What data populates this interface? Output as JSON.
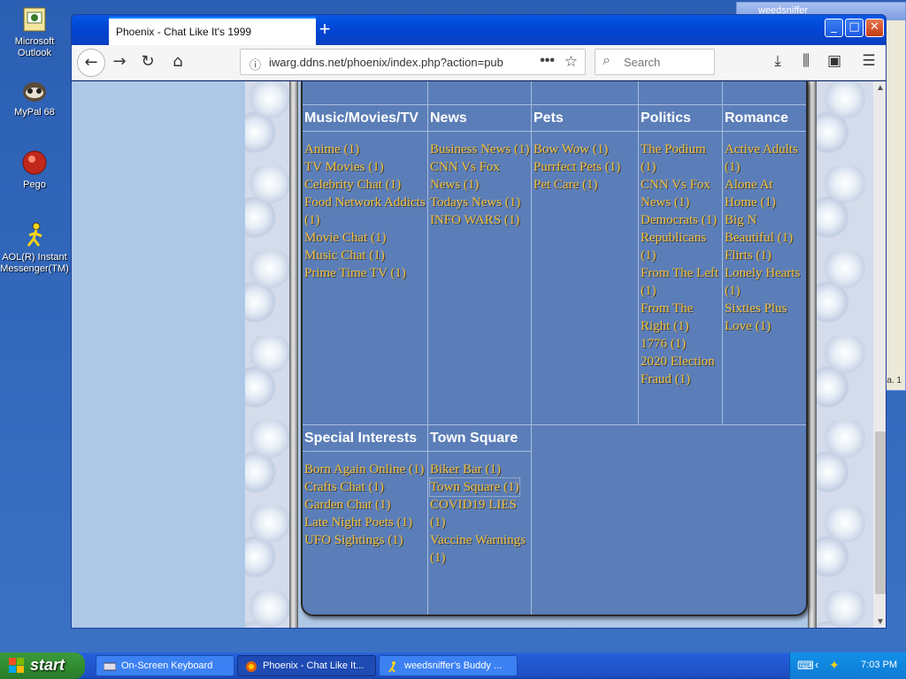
{
  "desktop": {
    "icons": [
      {
        "label": "Microsoft Outlook",
        "icon": "outlook-icon"
      },
      {
        "label": "MyPal 68",
        "icon": "mypal-icon"
      },
      {
        "label": "Pego",
        "icon": "pego-icon"
      },
      {
        "label": "AOL(R) Instant Messenger(TM)",
        "icon": "aim-icon"
      }
    ]
  },
  "browser": {
    "tab_title": "Phoenix - Chat Like It's 1999",
    "new_tab": "+",
    "url": "iwarg.ddns.net/phoenix/index.php?action=pub",
    "search_placeholder": "Search",
    "url_actions": "•••"
  },
  "chat": {
    "columns_top": [
      {
        "heading": "Music/Movies/TV",
        "rooms": [
          "Anime (1)",
          "TV Movies (1)",
          "Celebrity Chat (1)",
          "Food Network Addicts (1)",
          "Movie Chat (1)",
          "Music Chat (1)",
          "Prime Time TV (1)"
        ]
      },
      {
        "heading": "News",
        "rooms": [
          "Business News (1)",
          "CNN Vs Fox News (1)",
          "Todays News (1)",
          "INFO WARS (1)"
        ]
      },
      {
        "heading": "Pets",
        "rooms": [
          "Bow Wow (1)",
          "Purrfect Pets (1)",
          "Pet Care (1)"
        ]
      },
      {
        "heading": "Politics",
        "rooms": [
          "The Podium (1)",
          "CNN Vs Fox News (1)",
          "Democrats (1)",
          "Republicans (1)",
          "From The Left (1)",
          "From The Right (1)",
          "1776 (1)",
          "2020 Election Fraud (1)"
        ]
      },
      {
        "heading": "Romance",
        "rooms": [
          "Active Adults (1)",
          "Alone At Home (1)",
          "Big N Beautiful (1)",
          "Flirts (1)",
          "Lonely Hearts (1)",
          "Sixties Plus Love (1)"
        ]
      }
    ],
    "columns_bottom": [
      {
        "heading": "Special Interests",
        "rooms": [
          "Born Again Online (1)",
          "Crafts Chat (1)",
          "Garden Chat (1)",
          "Late Night Poets (1)",
          "UFO Sightings (1)"
        ]
      },
      {
        "heading": "Town Square",
        "rooms": [
          "Biker Bar (1)",
          "Town Square (1)",
          "COVID19 LIES (1)",
          "Vaccine Warnings (1)"
        ]
      }
    ]
  },
  "taskbar": {
    "start_label": "start",
    "items": [
      {
        "label": "On-Screen Keyboard",
        "icon": "keyboard-icon",
        "active": false
      },
      {
        "label": "Phoenix - Chat Like It...",
        "icon": "firefox-icon",
        "active": true
      },
      {
        "label": "weedsniffer's Buddy ...",
        "icon": "aim-icon",
        "active": false
      }
    ],
    "clock": "7:03 PM"
  },
  "background_window": {
    "title": "weedsniffer",
    "snippet": "a. 1"
  },
  "colors": {
    "panel": "#5b7eb8",
    "link": "#f0c040",
    "heading": "#ffffff",
    "titlebar": "#0047d6"
  }
}
